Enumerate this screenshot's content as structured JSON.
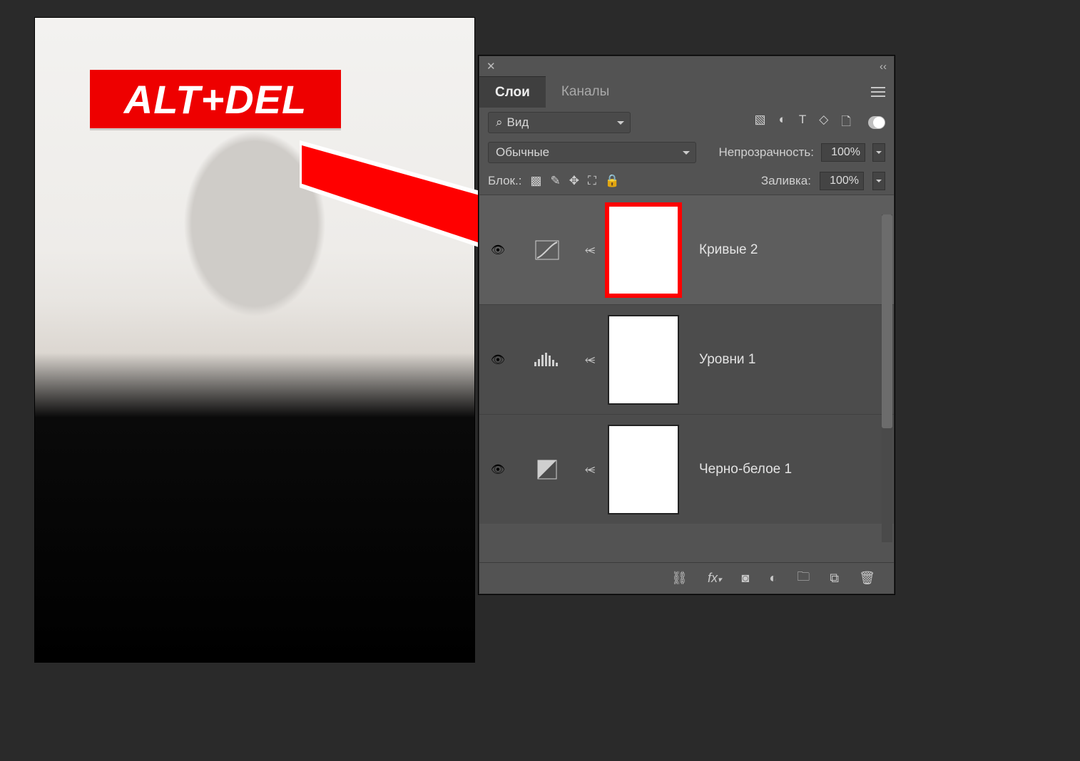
{
  "shortcut_badge": "ALT+DEL",
  "panel": {
    "tabs": {
      "layers": "Слои",
      "channels": "Каналы"
    },
    "kind_dropdown": {
      "prefix_icon": "search-icon",
      "value": "Вид"
    },
    "filter_icons": [
      "pixel-filter-icon",
      "adjustment-filter-icon",
      "type-filter-icon",
      "shape-filter-icon",
      "smart-filter-icon"
    ],
    "blend_mode": "Обычные",
    "opacity_label": "Непрозрачность:",
    "opacity_value": "100%",
    "lock_label": "Блок.:",
    "lock_icons": [
      "transparency-lock-icon",
      "brush-lock-icon",
      "move-lock-icon",
      "artboard-lock-icon",
      "all-lock-icon"
    ],
    "fill_label": "Заливка:",
    "fill_value": "100%",
    "layers": [
      {
        "name": "Кривые 2",
        "adj_icon": "curves-icon",
        "selected": true,
        "highlight_mask": true
      },
      {
        "name": "Уровни 1",
        "adj_icon": "levels-icon",
        "selected": false,
        "highlight_mask": false
      },
      {
        "name": "Черно-белое 1",
        "adj_icon": "black-white-icon",
        "selected": false,
        "highlight_mask": false
      }
    ],
    "footer_icons": [
      "link-layers-icon",
      "layer-fx-icon",
      "add-mask-icon",
      "new-adjustment-icon",
      "new-group-icon",
      "new-layer-icon",
      "trash-icon"
    ]
  }
}
